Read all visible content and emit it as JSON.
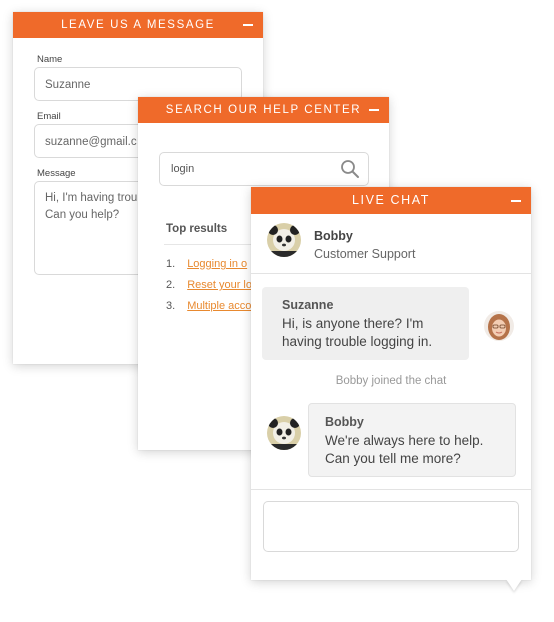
{
  "message_panel": {
    "title": "LEAVE US A MESSAGE",
    "name_label": "Name",
    "name_value": "Suzanne",
    "email_label": "Email",
    "email_value": "suzanne@gmail.c",
    "message_label": "Message",
    "message_line1": "Hi, I'm having troub",
    "message_line2": "Can you help?"
  },
  "help_panel": {
    "title": "SEARCH OUR HELP CENTER",
    "search_value": "login",
    "top_results_label": "Top results",
    "results": [
      {
        "num": "1.",
        "text": "Logging in o"
      },
      {
        "num": "2.",
        "text": "Reset your lo"
      },
      {
        "num": "3.",
        "text": "Multiple acco"
      }
    ]
  },
  "chat_panel": {
    "title": "LIVE CHAT",
    "agent_name": "Bobby",
    "agent_role": "Customer Support",
    "messages": [
      {
        "sender": "Suzanne",
        "line1": "Hi, is anyone there? I'm",
        "line2": "having trouble logging in."
      },
      {
        "sender": "Bobby",
        "line1": "We're always here to help.",
        "line2": "Can you tell me more?"
      }
    ],
    "system_message": "Bobby joined the chat"
  },
  "colors": {
    "accent": "#ef6a2a",
    "link": "#e8892f"
  }
}
